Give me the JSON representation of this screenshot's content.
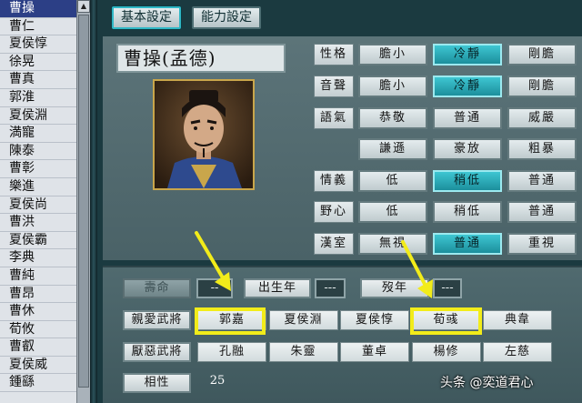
{
  "name_list": {
    "items": [
      "曹操",
      "曹仁",
      "夏侯惇",
      "徐晃",
      "曹真",
      "郭淮",
      "夏侯淵",
      "満寵",
      "陳泰",
      "曹彰",
      "樂進",
      "夏侯尚",
      "曹洪",
      "夏侯霸",
      "李典",
      "曹純",
      "曹昂",
      "曹休",
      "荀攸",
      "曹叡",
      "夏侯威",
      "鍾繇"
    ],
    "selected_index": 0
  },
  "tabs": {
    "basic": "基本設定",
    "ability": "能力設定"
  },
  "general": {
    "name": "曹操(孟德)"
  },
  "attributes": [
    {
      "label": "性格",
      "options": [
        "膽小",
        "冷靜",
        "剛膽"
      ],
      "active": 1
    },
    {
      "label": "音聲",
      "options": [
        "膽小",
        "冷靜",
        "剛膽"
      ],
      "active": 1
    },
    {
      "label": "語氣",
      "options": [
        "恭敬",
        "普通",
        "威嚴"
      ],
      "active": -1
    },
    {
      "label": "",
      "options": [
        "謙遜",
        "豪放",
        "粗暴"
      ],
      "active": -1
    },
    {
      "label": "情義",
      "options": [
        "低",
        "稍低",
        "普通"
      ],
      "active": 1
    },
    {
      "label": "野心",
      "options": [
        "低",
        "稍低",
        "普通"
      ],
      "active": -1
    },
    {
      "label": "漢室",
      "options": [
        "無視",
        "普通",
        "重視"
      ],
      "active": 1
    }
  ],
  "lifespan": {
    "button": "壽命",
    "value": "--",
    "birth_label": "出生年",
    "birth_value": "---",
    "death_label": "歿年",
    "death_value": "---"
  },
  "liked_generals": {
    "button": "親愛武將",
    "names": [
      "郭嘉",
      "夏侯淵",
      "夏侯惇",
      "荀彧",
      "典韋"
    ]
  },
  "disliked_generals": {
    "button": "厭惡武將",
    "names": [
      "孔融",
      "朱靈",
      "董卓",
      "楊修",
      "左慈"
    ]
  },
  "compatibility": {
    "button": "相性",
    "value": "25"
  },
  "watermark": "头条 @奕道君心",
  "colors": {
    "accent": "#1c8f9c",
    "highlight": "#f2ec1a",
    "selected_list": "#2c3f86"
  }
}
